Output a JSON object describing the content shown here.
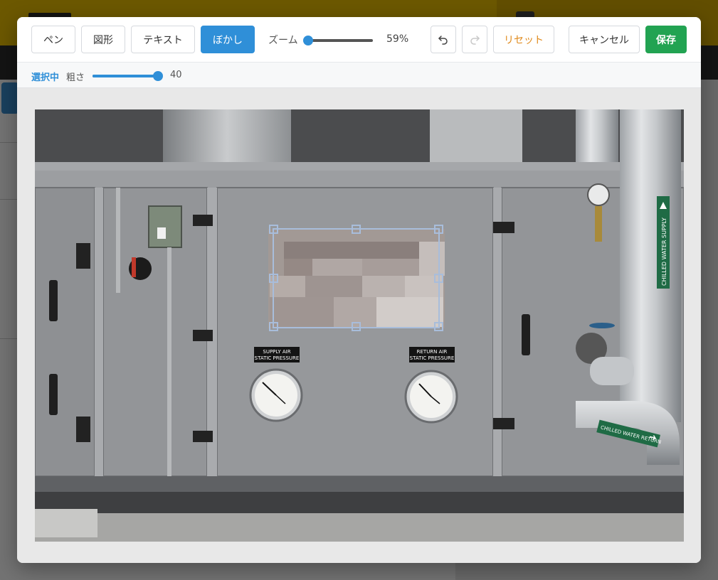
{
  "toolbar": {
    "pen_label": "ペン",
    "shape_label": "図形",
    "text_label": "テキスト",
    "blur_label": "ぼかし",
    "zoom_label": "ズーム",
    "zoom_percent": "59%",
    "zoom_value": 0.59,
    "reset_label": "リセット",
    "cancel_label": "キャンセル",
    "save_label": "保存"
  },
  "subbar": {
    "selected_label": "選択中",
    "thickness_label": "粗さ",
    "thickness_value": "40"
  },
  "photo": {
    "gauge_left_label_1": "SUPPLY AIR",
    "gauge_left_label_2": "STATIC PRESSURE",
    "gauge_right_label_1": "RETURN AIR",
    "gauge_right_label_2": "STATIC PRESSURE",
    "pipe_label_supply": "CHILLED WATER SUPPLY",
    "pipe_label_return": "CHILLED WATER RETURN"
  },
  "icons": {
    "undo": "undo-icon",
    "redo": "redo-icon",
    "pipe_arrow": "arrow-icon"
  },
  "colors": {
    "accent": "#2f8fd8",
    "save": "#22a352",
    "reset": "#e08a1c",
    "topbar": "#f0c400"
  }
}
